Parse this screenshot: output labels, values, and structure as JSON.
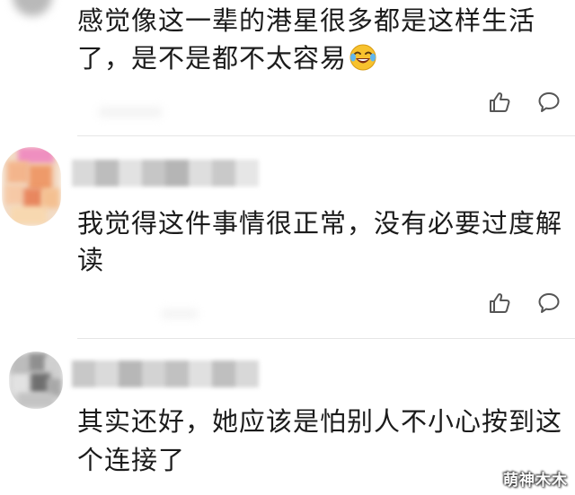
{
  "comments": [
    {
      "text_line1": "感觉像这一辈的港星很多都是这样生活",
      "text_line2": "了，是不是都不太容易",
      "emoji": "laughing-tears-emoji"
    },
    {
      "text_line1": "我觉得这件事情很正常，没有必要过度解",
      "text_line2": "读"
    },
    {
      "text_line1": "其实还好，她应该是怕别人不小心按到这",
      "text_line2": "个连接了"
    }
  ],
  "icons": {
    "like": "thumbs-up-icon",
    "reply": "speech-bubble-icon"
  },
  "watermark": "萌神木木",
  "colors": {
    "text": "#1b1b1b",
    "icon": "#555555",
    "divider": "#e6e6e6",
    "background": "#ffffff"
  }
}
